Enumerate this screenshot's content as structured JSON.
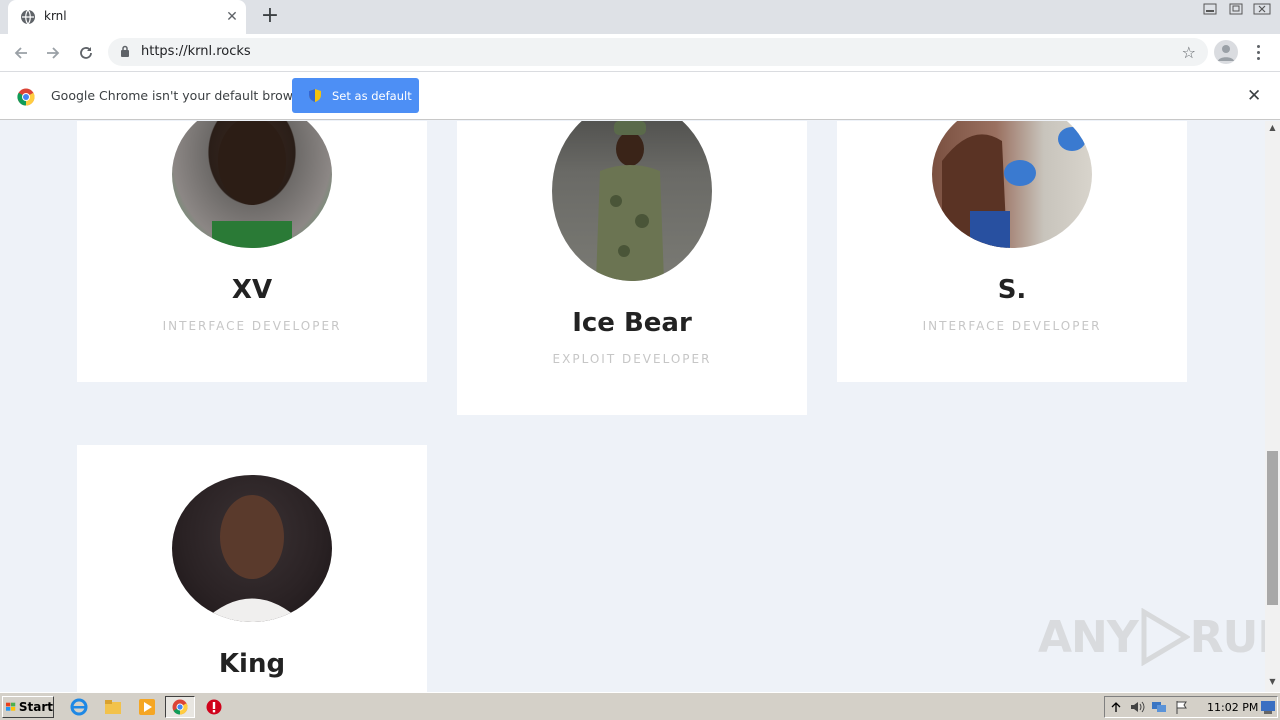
{
  "browser": {
    "tab_title": "krnl",
    "url": "https://krnl.rocks",
    "infobar_text": "Google Chrome isn't your default browser",
    "set_default_label": "Set as default"
  },
  "team": [
    {
      "name": "XV",
      "role": "INTERFACE DEVELOPER"
    },
    {
      "name": "Ice Bear",
      "role": "EXPLOIT DEVELOPER"
    },
    {
      "name": "S.",
      "role": "INTERFACE DEVELOPER"
    },
    {
      "name": "King",
      "role": ""
    }
  ],
  "watermark": {
    "left": "ANY",
    "right": "RUN"
  },
  "taskbar": {
    "start_label": "Start",
    "clock": "11:02 PM"
  },
  "colors": {
    "accent_button": "#4d8ff5",
    "page_bg": "#eef2f8",
    "card_bg": "#ffffff",
    "role_text": "#c6c6c6"
  }
}
